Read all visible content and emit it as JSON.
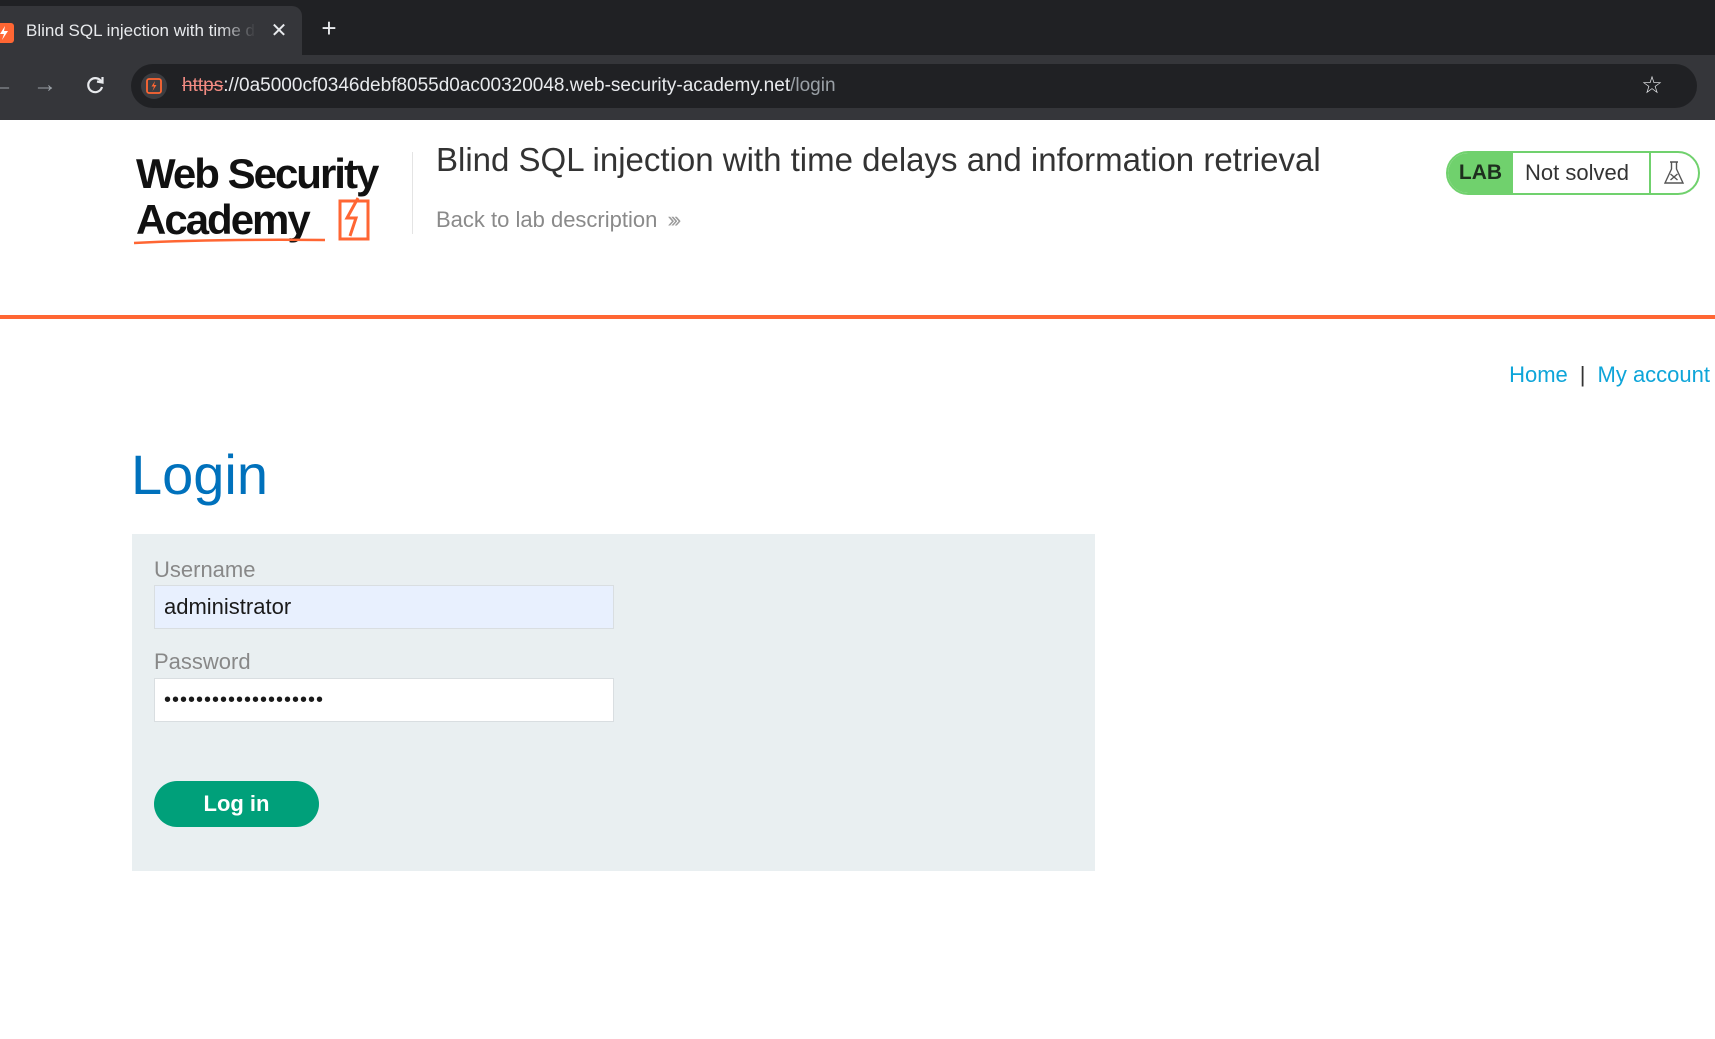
{
  "browser": {
    "tab_title": "Blind SQL injection with time delays and information retrieval",
    "url_scheme": "https",
    "url_rest": "://0a5000cf0346debf8055d0ac00320048.web-security-academy.net",
    "url_path": "/login",
    "icons": {
      "favicon": "burp-lightning-icon",
      "close": "close-icon",
      "new_tab": "plus-icon",
      "back": "arrow-left-icon",
      "forward": "arrow-right-icon",
      "reload": "reload-icon",
      "site_info": "site-info-icon",
      "bookmark": "star-icon"
    }
  },
  "header": {
    "logo_line1": "Web Security",
    "logo_line2": "Academy",
    "lab_title": "Blind SQL injection with time delays and information retrieval",
    "back_link": "Back to lab description",
    "lab_badge": "LAB",
    "lab_status": "Not solved",
    "colors": {
      "accent_orange": "#ff6633",
      "lab_green": "#70d16d"
    }
  },
  "nav": {
    "home": "Home",
    "separator": "|",
    "my_account": "My account"
  },
  "login": {
    "heading": "Login",
    "username_label": "Username",
    "username_value": "administrator",
    "password_label": "Password",
    "password_value": "••••••••••••••••••••",
    "submit_label": "Log in",
    "colors": {
      "heading": "#0071bc",
      "button": "#00a07a"
    }
  }
}
